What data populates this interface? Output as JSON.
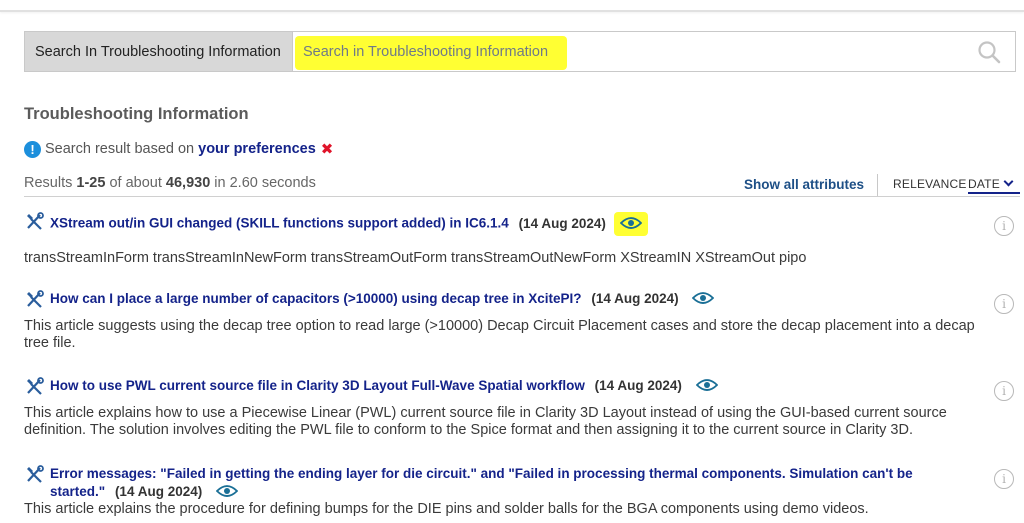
{
  "search": {
    "scope_label": "Search In Troubleshooting Information",
    "placeholder": "Search in Troubleshooting Information"
  },
  "section_title": "Troubleshooting Information",
  "preferences": {
    "prefix": "Search result based on",
    "link": "your preferences",
    "remove": "✖"
  },
  "results_summary": {
    "prefix": "Results",
    "range": "1-25",
    "of_about": "of about",
    "total": "46,930",
    "time": "in 2.60 seconds"
  },
  "show_all_attributes": "Show all attributes",
  "sort": {
    "relevance": "RELEVANCE",
    "date": "DATE"
  },
  "results": [
    {
      "title": "XStream out/in GUI changed (SKILL functions support added) in IC6.1.4",
      "date": "(14 Aug 2024)",
      "description": "transStreamInForm transStreamInNewForm transStreamOutForm transStreamOutNewForm XStreamIN XStreamOut pipo"
    },
    {
      "title": "How can I place a large number of capacitors (>10000) using decap tree in XcitePI?",
      "date": "(14 Aug 2024)",
      "description": "This article suggests using the decap tree option to read large (>10000) Decap Circuit Placement cases and store the decap placement into a decap tree file."
    },
    {
      "title": "How to use PWL current source file in Clarity 3D Layout Full-Wave Spatial workflow",
      "date": "(14 Aug 2024)",
      "description": "This article explains how to use a Piecewise Linear (PWL) current source file in Clarity 3D Layout instead of using the GUI-based current source definition. The solution involves editing the PWL file to conform to the Spice format and then assigning it to the current source in Clarity 3D."
    },
    {
      "title": "Error messages: \"Failed in getting the ending layer for die circuit.\" and \"Failed in processing thermal components. Simulation can't be started.\"",
      "date": "(14 Aug 2024)",
      "description": "This article explains the procedure for defining bumps for the DIE pins and solder balls for the BGA components using demo videos."
    }
  ],
  "colors": {
    "link": "#14238a",
    "highlight": "#ffff33",
    "eye": "#1a6f96",
    "tool_icon": "#2a5d9c",
    "remove": "#e0142a"
  },
  "icons": {
    "search": "search-icon",
    "result_type": "wrench-screwdriver-icon",
    "view": "eye-icon",
    "info": "info-circle-icon"
  }
}
